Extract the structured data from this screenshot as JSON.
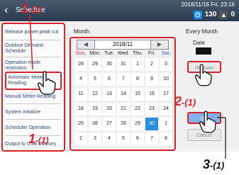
{
  "header": {
    "title": "Schedule",
    "datetime": "2018/11/16 Fri. 23:16",
    "power_value": "130",
    "warning_count": "0"
  },
  "sidebar": {
    "items": [
      {
        "label": "Release power peak cut"
      },
      {
        "label": "Outdoor Demand Schedule"
      },
      {
        "label": "Operation mode restriction"
      },
      {
        "label": "Automatic Meter-Reading"
      },
      {
        "label": "Manual Meter-Reading"
      },
      {
        "label": "System initialize"
      },
      {
        "label": "Scheduler Operation"
      },
      {
        "label": "Output to USB memory"
      }
    ]
  },
  "calendar": {
    "section_label": "Month",
    "year_month": "2018/11",
    "weekdays": [
      "Sun.",
      "Mon.",
      "Tue.",
      "Wed.",
      "Thu.",
      "Fri.",
      "Sat."
    ],
    "weeks": [
      [
        "28",
        "29",
        "30",
        "31",
        "1",
        "2",
        "3"
      ],
      [
        "4",
        "5",
        "6",
        "7",
        "8",
        "9",
        "10"
      ],
      [
        "11",
        "12",
        "13",
        "14",
        "15",
        "16",
        "17"
      ],
      [
        "18",
        "19",
        "20",
        "21",
        "22",
        "23",
        "24"
      ],
      [
        "25",
        "26",
        "27",
        "28",
        "29",
        "30",
        "1"
      ],
      [
        "2",
        "3",
        "4",
        "5",
        "6",
        "7",
        "8"
      ]
    ],
    "selected_day": "30"
  },
  "every_month": {
    "label": "Every Month",
    "date_label": "Date",
    "register_label": "Register",
    "ok_label": "OK",
    "cancel_label": "Cancel"
  },
  "annotations": {
    "a1": "1",
    "a1_sub2": "-(2)",
    "a1_sub1": "-(1)",
    "a2": "2",
    "a2_sub": "-(1)",
    "a3": "3",
    "a3_sub": "-(1)"
  },
  "colors": {
    "accent_red": "#d8222a",
    "selected_blue": "#2a8fd8"
  }
}
